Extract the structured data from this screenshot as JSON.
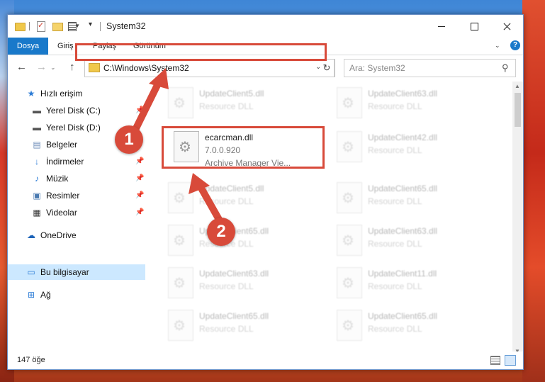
{
  "window": {
    "title": "System32"
  },
  "ribbon": {
    "tabs": [
      "Dosya",
      "Giriş",
      "Paylaş",
      "Görünüm"
    ],
    "help": "?"
  },
  "nav": {
    "address": "C:\\Windows\\System32",
    "search_placeholder": "Ara: System32"
  },
  "sidebar": {
    "items": [
      {
        "label": "Hızlı erişim",
        "icon": "star-icon"
      },
      {
        "label": "Yerel Disk (C:)",
        "icon": "drive-icon",
        "pinned": true
      },
      {
        "label": "Yerel Disk (D:)",
        "icon": "drive-icon"
      },
      {
        "label": "Belgeler",
        "icon": "document-icon"
      },
      {
        "label": "İndirmeler",
        "icon": "download-icon",
        "pinned": true
      },
      {
        "label": "Müzik",
        "icon": "music-icon",
        "pinned": true
      },
      {
        "label": "Resimler",
        "icon": "pictures-icon",
        "pinned": true
      },
      {
        "label": "Videolar",
        "icon": "video-icon",
        "pinned": true
      },
      {
        "label": "OneDrive",
        "icon": "cloud-icon"
      },
      {
        "label": "Bu bilgisayar",
        "icon": "computer-icon",
        "selected": true
      },
      {
        "label": "Ağ",
        "icon": "network-icon"
      }
    ]
  },
  "files": {
    "featured": {
      "name": "ecarcman.dll",
      "version": "7.0.0.920",
      "description": "Archive Manager Vie..."
    },
    "blurred": [
      {
        "name": "UpdateClient5.dll",
        "type": "Resource DLL"
      },
      {
        "name": "UpdateClient63.dll",
        "type": "Resource DLL"
      },
      {
        "name": "UpdateClient42.dll",
        "type": "Resource DLL"
      },
      {
        "name": "UpdateClient5.dll",
        "type": "Resource DLL"
      },
      {
        "name": "UpdateClient65.dll",
        "type": "Resource DLL"
      },
      {
        "name": "UpdateClient65.dll",
        "type": "Resource DLL"
      },
      {
        "name": "UpdateClient63.dll",
        "type": "Resource DLL"
      },
      {
        "name": "UpdateClient63.dll",
        "type": "Resource DLL"
      },
      {
        "name": "UpdateClient11.dll",
        "type": "Resource DLL"
      },
      {
        "name": "UpdateClient65.dll",
        "type": "Resource DLL"
      },
      {
        "name": "UpdateClient65.dll",
        "type": "Resource DLL"
      }
    ]
  },
  "status": {
    "count": "147 öğe"
  },
  "annotations": {
    "step1": "1",
    "step2": "2"
  },
  "colors": {
    "accent": "#1979ca",
    "highlight": "#d84a3a",
    "selected": "#cce8ff"
  }
}
